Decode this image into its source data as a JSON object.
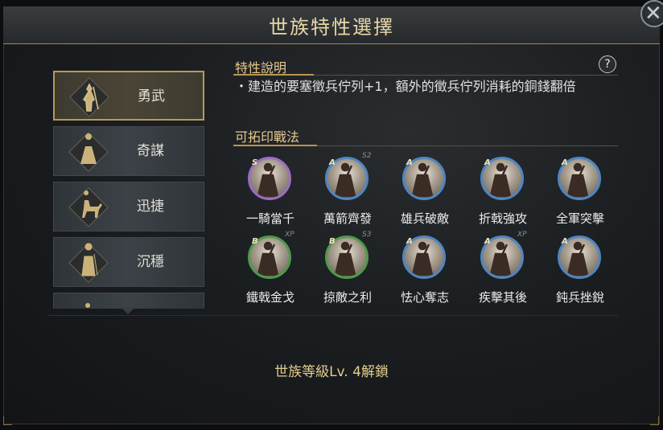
{
  "window": {
    "title": "世族特性選擇",
    "close_icon": "close-x-icon"
  },
  "traits": [
    {
      "label": "勇武",
      "icon": "warrior-icon",
      "selected": true
    },
    {
      "label": "奇謀",
      "icon": "strategist-icon",
      "selected": false
    },
    {
      "label": "迅捷",
      "icon": "cavalry-icon",
      "selected": false
    },
    {
      "label": "沉穩",
      "icon": "steady-general-icon",
      "selected": false
    },
    {
      "label": "",
      "icon": "general-icon",
      "selected": false
    }
  ],
  "description": {
    "header": "特性說明",
    "help_label": "?",
    "text": "・建造的要塞徵兵佇列+1，額外的徵兵佇列消耗的銅錢翻倍"
  },
  "tactics": {
    "header": "可拓印戰法",
    "skills": [
      {
        "name": "一騎當千",
        "grade": "S",
        "tag": "",
        "ring": "#9b6cc4"
      },
      {
        "name": "萬箭齊發",
        "grade": "A",
        "tag": "S2",
        "ring": "#4f86c2"
      },
      {
        "name": "雄兵破敵",
        "grade": "A",
        "tag": "",
        "ring": "#4f86c2"
      },
      {
        "name": "折戟強攻",
        "grade": "A",
        "tag": "",
        "ring": "#4f86c2"
      },
      {
        "name": "全軍突擊",
        "grade": "A",
        "tag": "",
        "ring": "#4f86c2"
      },
      {
        "name": "鐵戟金戈",
        "grade": "B",
        "tag": "XP",
        "ring": "#4e9a4a"
      },
      {
        "name": "掠敵之利",
        "grade": "B",
        "tag": "S3",
        "ring": "#4e9a4a"
      },
      {
        "name": "怯心奪志",
        "grade": "A",
        "tag": "",
        "ring": "#4f86c2"
      },
      {
        "name": "疾擊其後",
        "grade": "A",
        "tag": "XP",
        "ring": "#4f86c2"
      },
      {
        "name": "鈍兵挫銳",
        "grade": "A",
        "tag": "",
        "ring": "#4f86c2"
      }
    ]
  },
  "footer": {
    "unlock_text": "世族等級Lv. 4解鎖"
  },
  "colors": {
    "accent": "#b7964e",
    "title": "#e8d9a8",
    "unlock": "#e2cd8c"
  }
}
